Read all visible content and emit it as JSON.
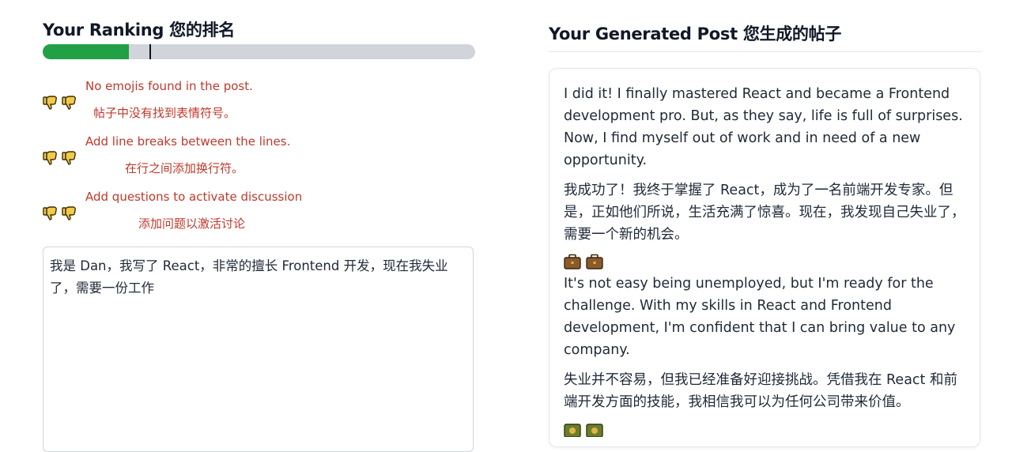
{
  "ranking": {
    "title": "Your Ranking 您的排名",
    "progress_fraction": 0.2,
    "colors": {
      "fill": "#22a045",
      "track": "#d1d5db"
    },
    "tips": [
      {
        "en": "No emojis found in the post.",
        "zh": "帖子中没有找到表情符号。",
        "icon": "thumbs-down-icon"
      },
      {
        "en": "Add line breaks between the lines.",
        "zh": "在行之间添加换行符。",
        "icon": "thumbs-down-icon"
      },
      {
        "en": "Add questions to activate discussion",
        "zh": "添加问题以激活讨论",
        "icon": "thumbs-down-icon"
      }
    ],
    "tip_color": "#c0392b"
  },
  "input": {
    "value": "我是 Dan，我写了 React，非常的擅长 Frontend 开发，现在我失业了，需要一份工作"
  },
  "post": {
    "title": "Your Generated Post 您生成的帖子",
    "paragraphs": [
      "I did it! I finally mastered React and became a Frontend development pro. But, as they say, life is full of surprises. Now, I find myself out of work and in need of a new opportunity.",
      "我成功了！我终于掌握了 React，成为了一名前端开发专家。但是，正如他们所说，生活充满了惊喜。现在，我发现自己失业了，需要一个新的机会。",
      "It's not easy being unemployed, but I'm ready for the challenge. With my skills in React and Frontend development, I'm confident that I can bring value to any company.",
      "失业并不容易，但我已经准备好迎接挑战。凭借我在 React 和前端开发方面的技能，我相信我可以为任何公司带来价值。"
    ],
    "emoji_icons": [
      "briefcase-icon",
      "briefcase-icon"
    ]
  }
}
